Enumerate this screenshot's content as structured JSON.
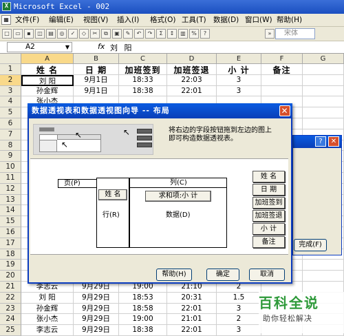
{
  "app": {
    "title": "Microsoft Excel - 002",
    "icon": "excel-icon"
  },
  "menu": [
    "文件(F)",
    "编辑(E)",
    "视图(V)",
    "插入(I)",
    "格式(O)",
    "工具(T)",
    "数据(D)",
    "窗口(W)",
    "帮助(H)"
  ],
  "toolbar": {
    "font": "宋体"
  },
  "formula": {
    "cell": "A2",
    "fx": "fx",
    "value": "刘 阳"
  },
  "columns": [
    "A",
    "B",
    "C",
    "D",
    "E",
    "F",
    "G"
  ],
  "rows": [
    "1",
    "2",
    "3",
    "4",
    "5",
    "6",
    "7",
    "8",
    "9",
    "10",
    "11",
    "12",
    "13",
    "14",
    "15",
    "16",
    "17",
    "18",
    "19",
    "20",
    "21",
    "22",
    "23",
    "24",
    "25"
  ],
  "sheet": {
    "header": [
      "姓 名",
      "日 期",
      "加班签到",
      "加班签退",
      "小 计",
      "备注"
    ],
    "top": [
      [
        "刘 阳",
        "9月1日",
        "18:33",
        "22:03",
        "3",
        ""
      ],
      [
        "孙金辉",
        "9月1日",
        "18:38",
        "22:01",
        "3",
        ""
      ],
      [
        "张小杰",
        "",
        "",
        "",
        "",
        ""
      ]
    ],
    "bottom": [
      [
        "李志云",
        "9月29日",
        "19:00",
        "21:10",
        "2",
        ""
      ],
      [
        "刘 阳",
        "9月29日",
        "18:53",
        "20:31",
        "1.5",
        ""
      ],
      [
        "孙金辉",
        "9月29日",
        "18:58",
        "22:01",
        "3",
        ""
      ],
      [
        "张小杰",
        "9月29日",
        "19:00",
        "21:01",
        "2",
        ""
      ],
      [
        "李志云",
        "9月29日",
        "18:38",
        "22:01",
        "3",
        ""
      ]
    ]
  },
  "dialog": {
    "title": "数据透视表和数据透视图向导 -- 布局",
    "instruction": "将右边的字段按钮拖到左边的图上即可构造数据透视表。",
    "page_label": "页(P)",
    "column_label": "列(C)",
    "row_label": "行(R)",
    "data_label": "数据(D)",
    "row_field": "姓 名",
    "data_field": "求和项:小 计",
    "fields": [
      "姓 名",
      "日 期",
      "加班签到",
      "加班签退",
      "小 计",
      "备注"
    ],
    "buttons": {
      "help": "帮助(H)",
      "ok": "确定",
      "cancel": "取消"
    }
  },
  "bg_dialog": {
    "finish": "完成(F)",
    "help_icon": "?",
    "close_icon": "✕"
  },
  "watermark": {
    "brand": "百科全说",
    "slogan": "助你轻松解决"
  }
}
